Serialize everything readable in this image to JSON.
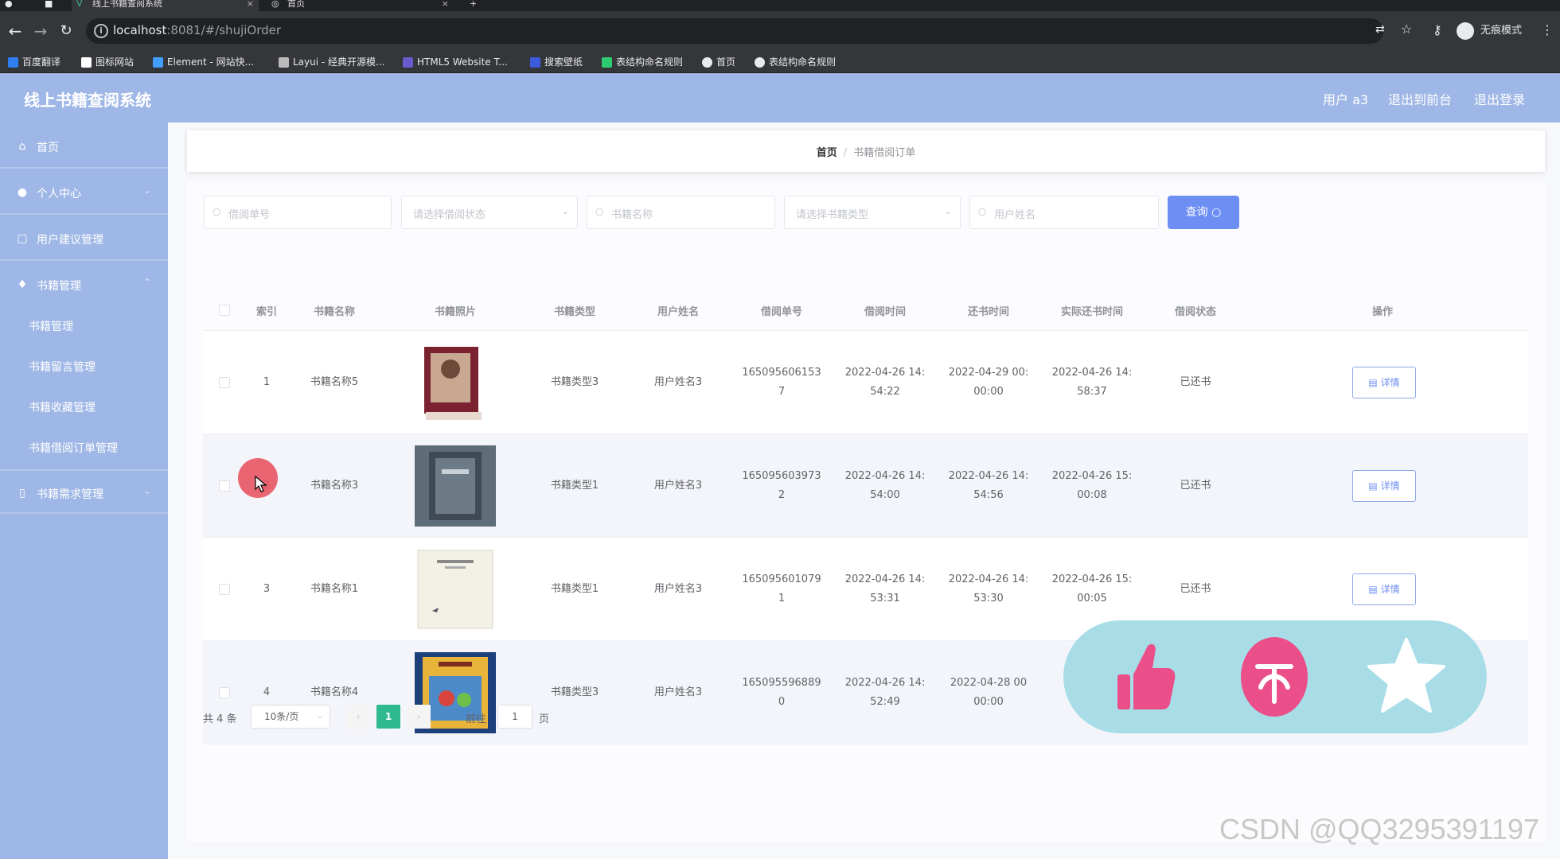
{
  "browser": {
    "tabs": [
      {
        "title": "线上书籍查阅系统",
        "icon": "vue-icon"
      },
      {
        "title": "首页",
        "icon": "globe-icon"
      }
    ],
    "url_host": "localhost",
    "url_rest": ":8081/#/shujiOrder",
    "incognito_label": "无痕模式",
    "bookmarks": [
      {
        "label": "百度翻译",
        "color": "#2f7ff0"
      },
      {
        "label": "图标网站",
        "color": "#ffffff"
      },
      {
        "label": "Element - 网站快...",
        "color": "#409eff"
      },
      {
        "label": "Layui - 经典开源模...",
        "color": "#e0e0e0"
      },
      {
        "label": "HTML5 Website T...",
        "color": "#6a5acd"
      },
      {
        "label": "搜索壁纸",
        "color": "#3b5bdb"
      },
      {
        "label": "表结构命名规则",
        "color": "#2ecc71"
      },
      {
        "label": "首页",
        "color": "#e8eaed"
      },
      {
        "label": "表结构命名规则",
        "color": "#e8eaed"
      }
    ]
  },
  "header": {
    "title": "线上书籍查阅系统",
    "user": "用户 a3",
    "to_front": "退出到前台",
    "logout": "退出登录"
  },
  "sidebar": {
    "items": [
      {
        "label": "首页",
        "icon": "home-icon"
      },
      {
        "label": "个人中心",
        "icon": "user-icon"
      },
      {
        "label": "用户建议管理",
        "icon": "suggestion-icon"
      },
      {
        "label": "书籍管理",
        "icon": "book-icon"
      },
      {
        "label": "书籍需求管理",
        "icon": "request-icon"
      }
    ],
    "sub_items": [
      "书籍管理",
      "书籍留言管理",
      "书籍收藏管理",
      "书籍借阅订单管理"
    ]
  },
  "breadcrumb": {
    "home": "首页",
    "separator": "/",
    "current": "书籍借阅订单"
  },
  "search": {
    "order_no_placeholder": "借阅单号",
    "status_placeholder": "请选择借阅状态",
    "book_name_placeholder": "书籍名称",
    "book_type_placeholder": "请选择书籍类型",
    "user_name_placeholder": "用户姓名",
    "button_label": "查询"
  },
  "table": {
    "columns": [
      "索引",
      "书籍名称",
      "书籍照片",
      "书籍类型",
      "用户姓名",
      "借阅单号",
      "借阅时间",
      "还书时间",
      "实际还书时间",
      "借阅状态",
      "操作"
    ],
    "rows": [
      {
        "index": "1",
        "book_name": "书籍名称5",
        "book_type": "书籍类型3",
        "user_name": "用户姓名3",
        "order_no": [
          "165095606153",
          "7"
        ],
        "borrow_time": [
          "2022-04-26 14:",
          "54:22"
        ],
        "return_time": [
          "2022-04-29 00:",
          "00:00"
        ],
        "actual_return_time": [
          "2022-04-26 14:",
          "58:37"
        ],
        "status": "已还书",
        "action": "详情"
      },
      {
        "index": "2",
        "book_name": "书籍名称3",
        "book_type": "书籍类型1",
        "user_name": "用户姓名3",
        "order_no": [
          "165095603973",
          "2"
        ],
        "borrow_time": [
          "2022-04-26 14:",
          "54:00"
        ],
        "return_time": [
          "2022-04-26 14:",
          "54:56"
        ],
        "actual_return_time": [
          "2022-04-26 15:",
          "00:08"
        ],
        "status": "已还书",
        "action": "详情"
      },
      {
        "index": "3",
        "book_name": "书籍名称1",
        "book_type": "书籍类型1",
        "user_name": "用户姓名3",
        "order_no": [
          "165095601079",
          "1"
        ],
        "borrow_time": [
          "2022-04-26 14:",
          "53:31"
        ],
        "return_time": [
          "2022-04-26 14:",
          "53:30"
        ],
        "actual_return_time": [
          "2022-04-26 15:",
          "00:05"
        ],
        "status": "已还书",
        "action": "详情"
      },
      {
        "index": "4",
        "book_name": "书籍名称4",
        "book_type": "书籍类型3",
        "user_name": "用户姓名3",
        "order_no": [
          "165095596889",
          "0"
        ],
        "borrow_time": [
          "2022-04-26 14:",
          "52:49"
        ],
        "return_time": [
          "2022-04-28 00",
          "00:00"
        ],
        "actual_return_time": [
          "",
          ""
        ],
        "status": "",
        "action": ""
      }
    ]
  },
  "pagination": {
    "total": "共 4 条",
    "page_size": "10条/页",
    "current_page": "1",
    "goto_label": "前往",
    "goto_value": "1",
    "page_unit": "页"
  },
  "watermark": "CSDN @QQ3295391197"
}
